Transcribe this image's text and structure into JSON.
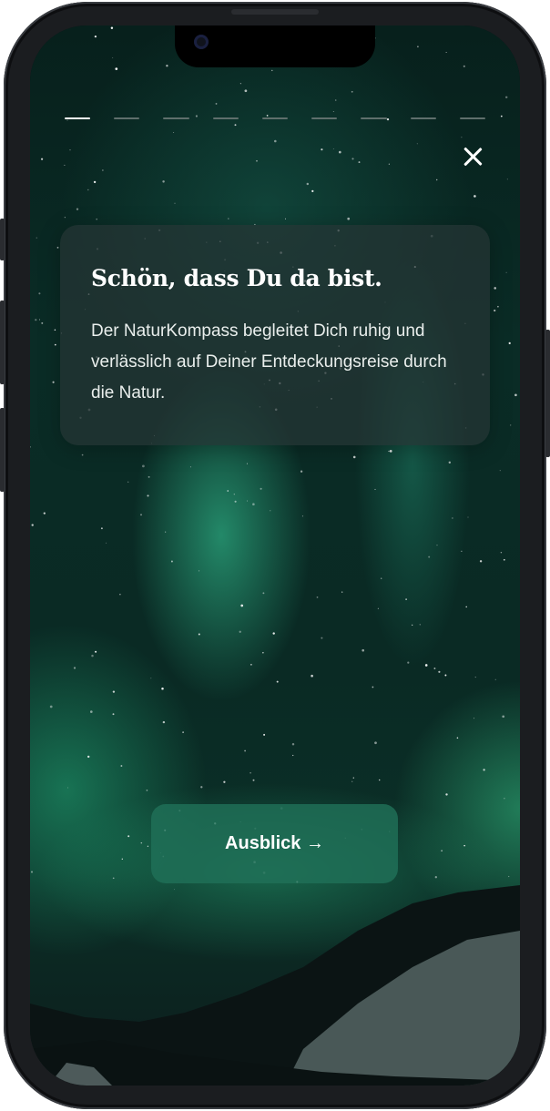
{
  "onboarding": {
    "progress": {
      "total_steps": 9,
      "current_step": 1
    },
    "close_icon": "close-icon",
    "card": {
      "title": "Schön, dass Du da bist.",
      "text": "Der NaturKompass begleitet Dich ruhig und verlässlich auf Deiner Entdeckungsreise durch die Natur."
    },
    "cta_label": "Ausblick →"
  },
  "colors": {
    "accent": "#1f6e57",
    "active_progress": "#ffffff",
    "inactive_progress": "#5f6f6c"
  }
}
